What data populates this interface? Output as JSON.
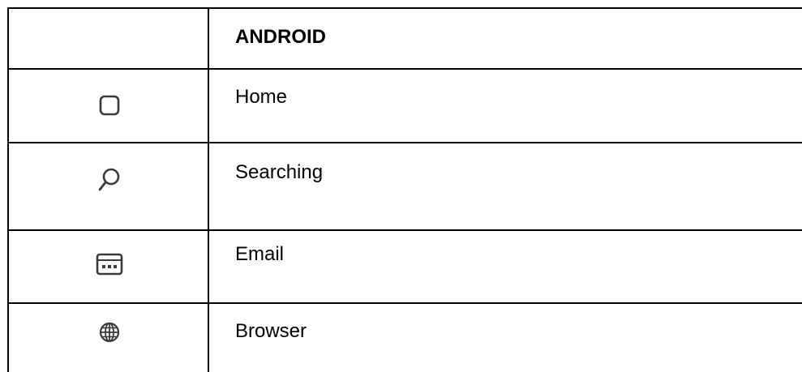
{
  "table": {
    "header": {
      "icon_col": "",
      "label_col": "ANDROID"
    },
    "rows": [
      {
        "icon": "home-square-icon",
        "label": "Home"
      },
      {
        "icon": "search-icon",
        "label": "Searching"
      },
      {
        "icon": "keyboard-icon",
        "label": "Email"
      },
      {
        "icon": "globe-icon",
        "label": "Browser"
      }
    ]
  }
}
